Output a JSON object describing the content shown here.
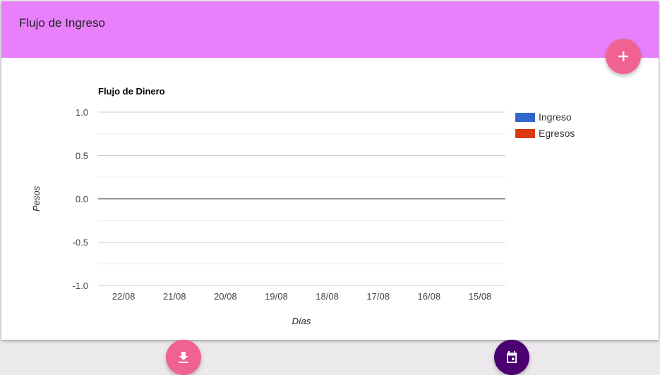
{
  "card": {
    "title": "Flujo de Ingreso"
  },
  "buttons": {
    "add": {
      "icon": "plus-icon",
      "color": "#f06292"
    },
    "download": {
      "icon": "download-icon",
      "color": "#f06292"
    },
    "calendar": {
      "icon": "calendar-icon",
      "color": "#4a0072"
    }
  },
  "colors": {
    "header": "#e880fb",
    "background": "#ece9ec",
    "ingreso": "#3366cc",
    "egresos": "#dc3912"
  },
  "chart_data": {
    "type": "bar",
    "title": "Flujo de Dinero",
    "xlabel": "Días",
    "ylabel": "Pesos",
    "categories": [
      "22/08",
      "21/08",
      "20/08",
      "19/08",
      "18/08",
      "17/08",
      "16/08",
      "15/08"
    ],
    "ylim": [
      -1.0,
      1.0
    ],
    "yticks": [
      "1.0",
      "0.5",
      "0.0",
      "-0.5",
      "-1.0"
    ],
    "grid": true,
    "legend_position": "right",
    "series": [
      {
        "name": "Ingreso",
        "color": "#3366cc",
        "values": [
          0,
          0,
          0,
          0,
          0,
          0,
          0,
          0
        ]
      },
      {
        "name": "Egresos",
        "color": "#dc3912",
        "values": [
          0,
          0,
          0,
          0,
          0,
          0,
          0,
          0
        ]
      }
    ]
  }
}
